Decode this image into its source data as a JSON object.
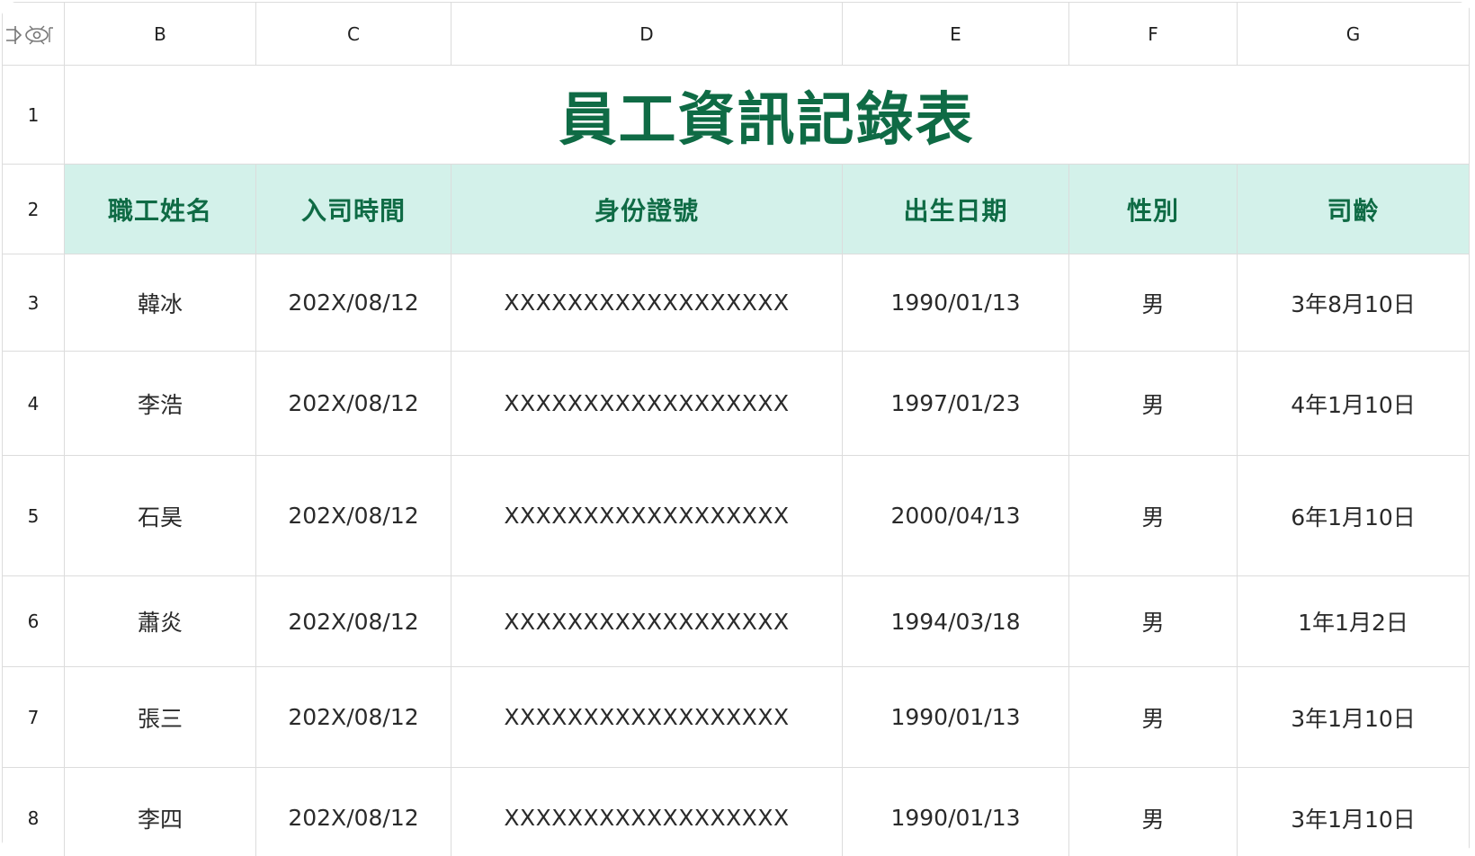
{
  "colors": {
    "accent_green": "#0f6b45",
    "header_fill": "#d3f1ea",
    "header_border": "#9fd6e8",
    "grid_line": "#dcdcdc"
  },
  "corner": {
    "icon": "select-all-icon"
  },
  "columns": [
    "B",
    "C",
    "D",
    "E",
    "F",
    "G"
  ],
  "rows": {
    "r1": "1",
    "r2": "2",
    "r3": "3",
    "r4": "4",
    "r5": "5",
    "r6": "6",
    "r7": "7",
    "r8": "8"
  },
  "title": "員工資訊記錄表",
  "headers": [
    "職工姓名",
    "入司時間",
    "身份證號",
    "出生日期",
    "性別",
    "司齡"
  ],
  "records": [
    [
      "韓冰",
      "202X/08/12",
      "XXXXXXXXXXXXXXXXXX",
      "1990/01/13",
      "男",
      "3年8月10日"
    ],
    [
      "李浩",
      "202X/08/12",
      "XXXXXXXXXXXXXXXXXX",
      "1997/01/23",
      "男",
      "4年1月10日"
    ],
    [
      "石昊",
      "202X/08/12",
      "XXXXXXXXXXXXXXXXXX",
      "2000/04/13",
      "男",
      "6年1月10日"
    ],
    [
      "蕭炎",
      "202X/08/12",
      "XXXXXXXXXXXXXXXXXX",
      "1994/03/18",
      "男",
      "1年1月2日"
    ],
    [
      "張三",
      "202X/08/12",
      "XXXXXXXXXXXXXXXXXX",
      "1990/01/13",
      "男",
      "3年1月10日"
    ],
    [
      "李四",
      "202X/08/12",
      "XXXXXXXXXXXXXXXXXX",
      "1990/01/13",
      "男",
      "3年1月10日"
    ]
  ]
}
